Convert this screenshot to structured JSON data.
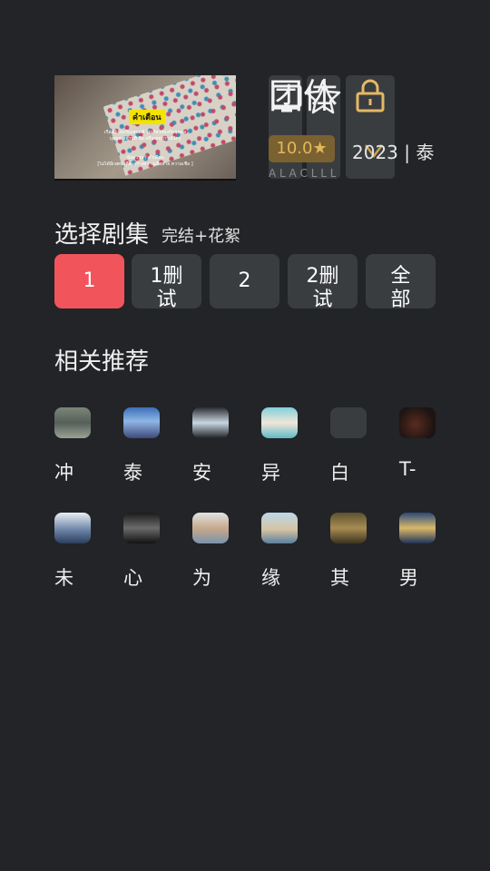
{
  "header": {
    "title": "团体",
    "rating": "10.0★",
    "meta": "2023 | 泰",
    "sub_overflow": "A L A C L L L"
  },
  "thumbnail": {
    "warning_text": "คำเตือน",
    "subtitle_1": "เรื่องนี้เป็นเรื่องสมมติ ไม่เกี่ยวข้องกับบุคคล",
    "subtitle_2": "บุคคล สถานที่ ชื่อ หรือเหตุการณ์ใดๆ",
    "subtitle_3": "ข้อความ / คำเตือน",
    "subtitle_4": "[ไม่ได้มีเจตนาที่จะสร้างความเสียหาย ความเชื่อ ]"
  },
  "top_buttons": [
    {
      "icon": "screen-icon"
    },
    {
      "icon": "star-icon"
    },
    {
      "icon": "lock-icon"
    }
  ],
  "episodes": {
    "title": "选择剧集",
    "note": "完结+花絮",
    "items": [
      {
        "label": "1",
        "label2": "",
        "active": true
      },
      {
        "label": "1删",
        "label2": "试",
        "active": false
      },
      {
        "label": "2",
        "label2": "",
        "active": false
      },
      {
        "label": "2删",
        "label2": "试",
        "active": false
      },
      {
        "label": "全",
        "label2": "部",
        "active": false
      }
    ]
  },
  "recommend": {
    "title": "相关推荐",
    "items": [
      {
        "label": "冲"
      },
      {
        "label": "泰"
      },
      {
        "label": "安"
      },
      {
        "label": "异"
      },
      {
        "label": "白"
      },
      {
        "label": "T-"
      },
      {
        "label": "未"
      },
      {
        "label": "心"
      },
      {
        "label": "为"
      },
      {
        "label": "缘"
      },
      {
        "label": "其"
      },
      {
        "label": "男"
      }
    ]
  },
  "colors": {
    "background": "#222427",
    "button": "#3a3d40",
    "accent": "#f2545b",
    "rating_bg": "#7a6131",
    "rating_text": "#e2b85a",
    "icon_gold": "#e4b965"
  }
}
